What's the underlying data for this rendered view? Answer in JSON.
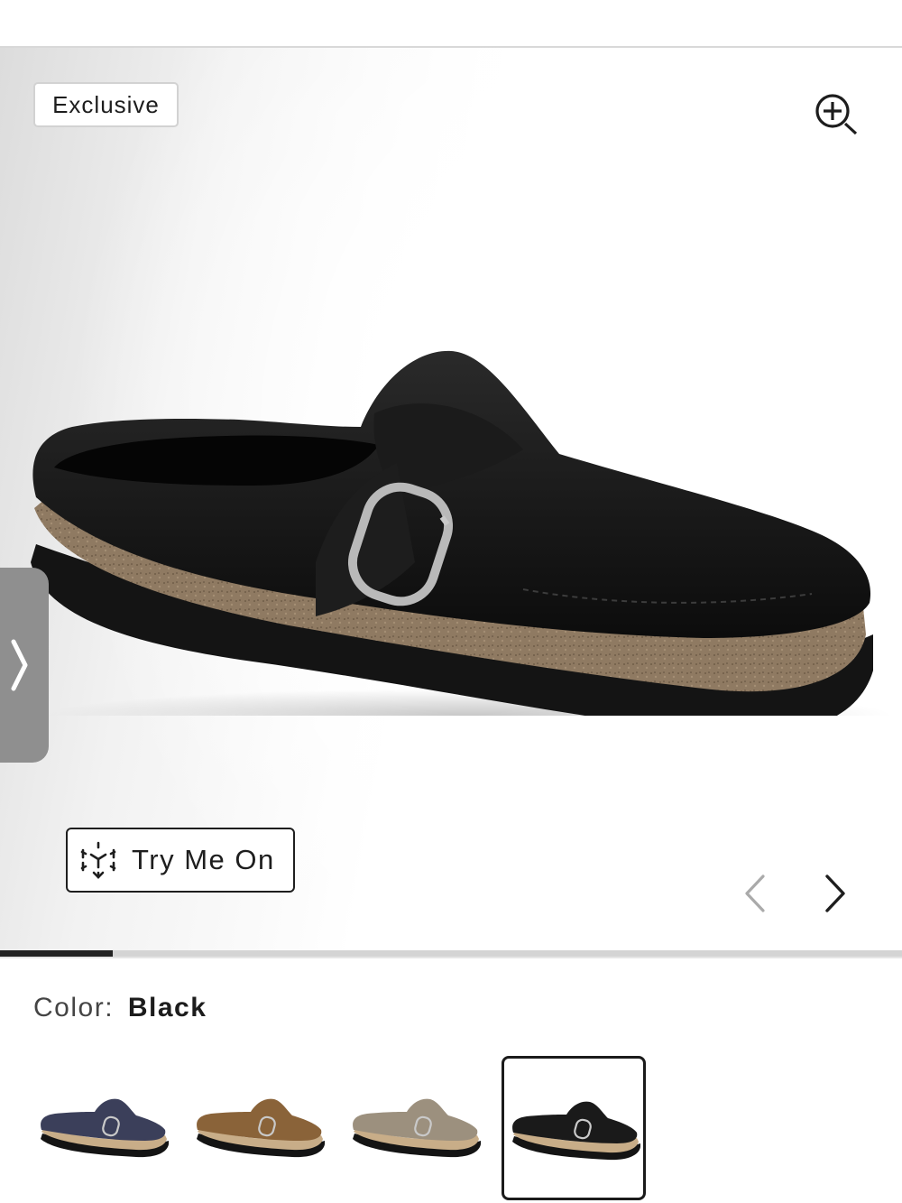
{
  "badge": {
    "label": "Exclusive"
  },
  "icons": {
    "zoom": "zoom-in-icon",
    "side_tab": "chevron-right-icon",
    "try_on": "ar-cube-icon",
    "prev": "chevron-left-icon",
    "next": "chevron-right-icon"
  },
  "gallery": {
    "try_on_label": "Try Me On",
    "progress": 0.125
  },
  "color": {
    "label": "Color:",
    "value": "Black"
  },
  "swatches": [
    {
      "color_name": "Navy",
      "upper": "#3b3f5a",
      "selected": false
    },
    {
      "color_name": "Tan",
      "upper": "#8a6339",
      "selected": false
    },
    {
      "color_name": "Taupe",
      "upper": "#9c907e",
      "selected": false
    },
    {
      "color_name": "Black",
      "upper": "#1a1a1a",
      "selected": true
    }
  ],
  "colors": {
    "accent": "#222222",
    "cork": "#8f7a62",
    "sole": "#141414"
  }
}
